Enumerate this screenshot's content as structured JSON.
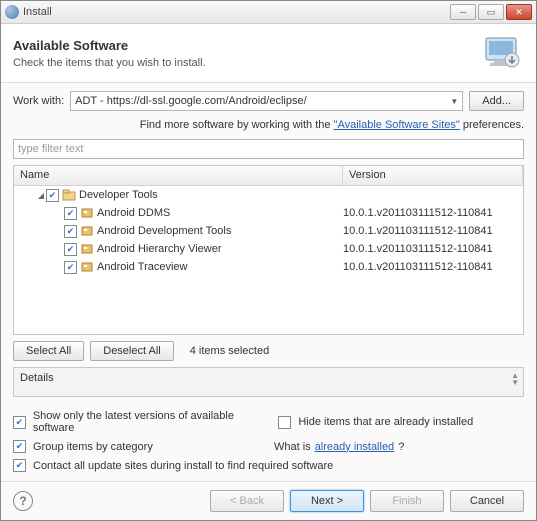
{
  "window": {
    "title": "Install"
  },
  "header": {
    "title": "Available Software",
    "subtitle": "Check the items that you wish to install."
  },
  "workwith": {
    "label": "Work with:",
    "value": "ADT - https://dl-ssl.google.com/Android/eclipse/",
    "add": "Add..."
  },
  "hint": {
    "prefix": "Find more software by working with the ",
    "link": "\"Available Software Sites\"",
    "suffix": " preferences."
  },
  "filter_placeholder": "type filter text",
  "columns": {
    "name": "Name",
    "version": "Version"
  },
  "tree": {
    "group": "Developer Tools",
    "items": [
      {
        "name": "Android DDMS",
        "version": "10.0.1.v201103111512-110841"
      },
      {
        "name": "Android Development Tools",
        "version": "10.0.1.v201103111512-110841"
      },
      {
        "name": "Android Hierarchy Viewer",
        "version": "10.0.1.v201103111512-110841"
      },
      {
        "name": "Android Traceview",
        "version": "10.0.1.v201103111512-110841"
      }
    ]
  },
  "selection": {
    "select_all": "Select All",
    "deselect_all": "Deselect All",
    "count": "4 items selected"
  },
  "details_label": "Details",
  "options": {
    "latest": "Show only the latest versions of available software",
    "hide_installed": "Hide items that are already installed",
    "group": "Group items by category",
    "whatis_prefix": "What is ",
    "whatis_link": "already installed",
    "whatis_suffix": "?",
    "contact": "Contact all update sites during install to find required software"
  },
  "footer": {
    "back": "< Back",
    "next": "Next >",
    "finish": "Finish",
    "cancel": "Cancel"
  }
}
